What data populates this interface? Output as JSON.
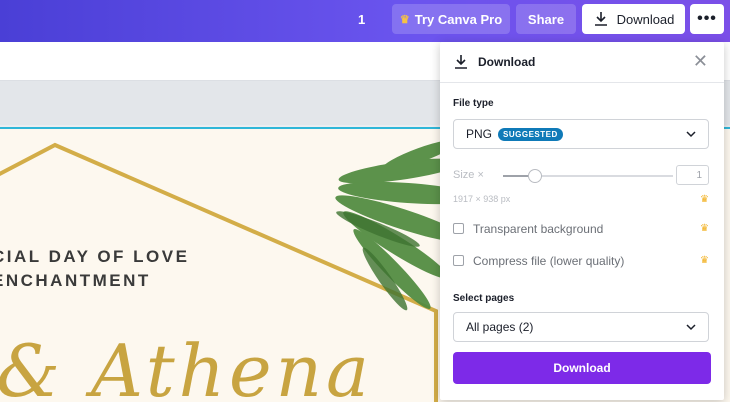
{
  "topbar": {
    "page_number": "1",
    "try_pro_label": "Try Canva Pro",
    "share_label": "Share",
    "download_label": "Download",
    "more_label": "•••"
  },
  "canvas": {
    "line1": "CIAL DAY OF LOVE",
    "line2": "ENCHANTMENT",
    "script": "& Athena"
  },
  "panel": {
    "title": "Download",
    "close_label": "✕",
    "file_type_label": "File type",
    "file_type_value": "PNG",
    "file_type_badge": "SUGGESTED",
    "size_label": "Size ×",
    "size_value": "1",
    "size_slider_fraction": 0.18,
    "dimensions": "1917 × 938 px",
    "transparent_label": "Transparent background",
    "compress_label": "Compress file (lower quality)",
    "select_pages_label": "Select pages",
    "select_pages_value": "All pages (2)",
    "download_button": "Download"
  },
  "colors": {
    "accent_purple": "#7d2ae8",
    "badge_blue": "#0f7ab8",
    "crown_gold": "#f2b01e",
    "topbar_start": "#4a3fd6",
    "topbar_end": "#7b4fe8"
  },
  "icons": [
    "crown-icon",
    "download-icon",
    "more-icon",
    "close-icon",
    "chevron-down-icon"
  ]
}
